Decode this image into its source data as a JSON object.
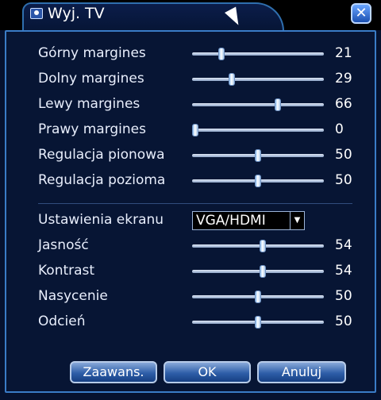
{
  "window": {
    "title": "Wyj. TV",
    "close_symbol": "✕"
  },
  "sliders": [
    {
      "label": "Górny margines",
      "value": "21",
      "level": 21
    },
    {
      "label": "Dolny margines",
      "value": "29",
      "level": 29
    },
    {
      "label": "Lewy margines",
      "value": "66",
      "level": 66
    },
    {
      "label": "Prawy margines",
      "value": "0",
      "level": 0
    },
    {
      "label": "Regulacja pionowa",
      "value": "50",
      "level": 50
    },
    {
      "label": "Regulacja pozioma",
      "value": "50",
      "level": 50
    }
  ],
  "display": {
    "label": "Ustawienia ekranu",
    "selected": "VGA/HDMI"
  },
  "image": [
    {
      "label": "Jasność",
      "value": "54",
      "level": 54
    },
    {
      "label": "Kontrast",
      "value": "54",
      "level": 54
    },
    {
      "label": "Nasycenie",
      "value": "50",
      "level": 50
    },
    {
      "label": "Odcień",
      "value": "50",
      "level": 50
    }
  ],
  "buttons": {
    "advanced": "Zaawans.",
    "ok": "OK",
    "cancel": "Anuluj"
  }
}
